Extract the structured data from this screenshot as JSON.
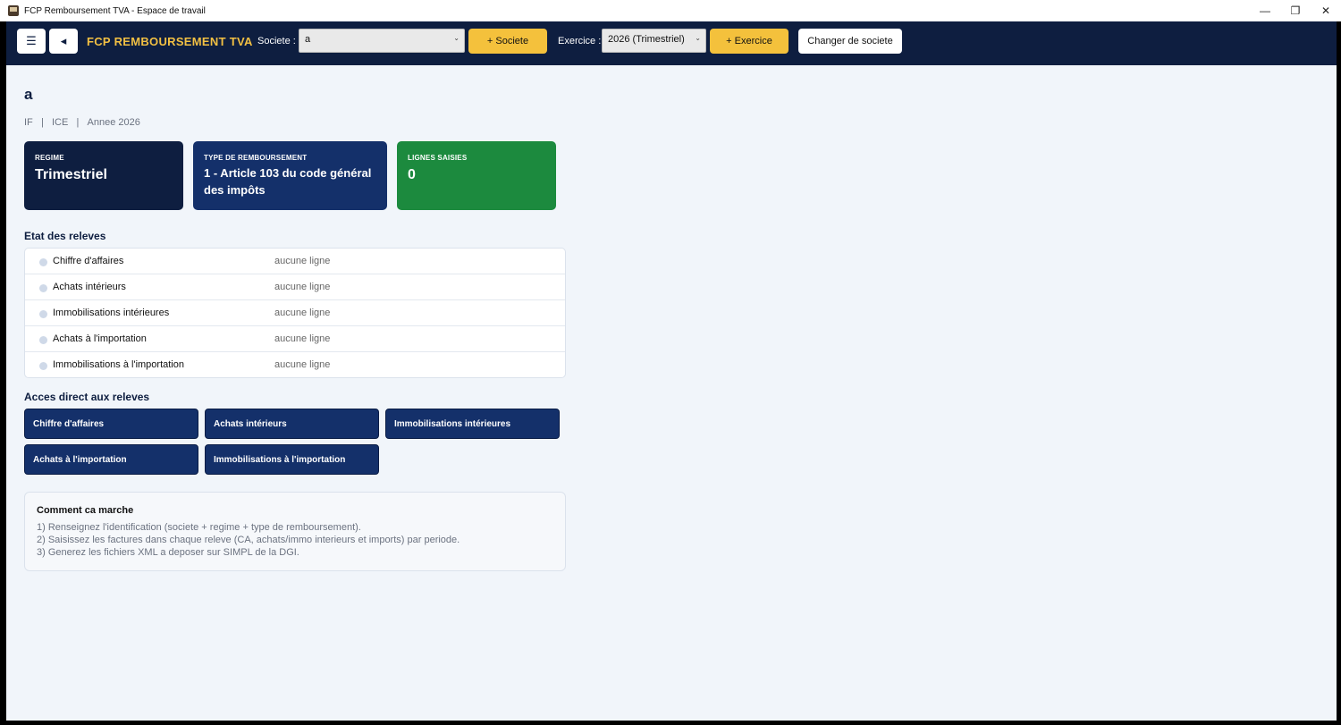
{
  "window": {
    "title": "FCP Remboursement TVA - Espace de travail",
    "controls": [
      "—",
      "❐",
      "✕"
    ]
  },
  "topbar": {
    "menu_icon": "☰",
    "back_icon": "◂",
    "brand": "FCP REMBOURSEMENT TVA",
    "societe_label": "Societe :",
    "societe_value": "a",
    "add_societe": "+ Societe",
    "exercice_label": "Exercice :",
    "exercice_value": "2026 (Trimestriel)",
    "add_exercice": "+ Exercice",
    "change_societe": "Changer de societe",
    "accent_color": "#f4c13c",
    "bar_color": "#0e1e40"
  },
  "main": {
    "company_name": "a",
    "meta": {
      "if": "IF",
      "sep1": "   |   ",
      "ice": "ICE",
      "sep2": "   |   ",
      "annee": "Annee 2026"
    },
    "cards": [
      {
        "caption": "REGIME",
        "value": "Trimestriel",
        "color": "#0e1e40"
      },
      {
        "caption": "TYPE DE REMBOURSEMENT",
        "value": "1 - Article 103 du code général des impôts",
        "color": "#14306a"
      },
      {
        "caption": "LIGNES SAISIES",
        "value": "0",
        "color": "#1c8a3e"
      }
    ],
    "status_title": "Etat des releves",
    "status_rows": [
      {
        "name": "Chiffre d'affaires",
        "state": "aucune ligne"
      },
      {
        "name": "Achats intérieurs",
        "state": "aucune ligne"
      },
      {
        "name": "Immobilisations intérieures",
        "state": "aucune ligne"
      },
      {
        "name": "Achats à l'importation",
        "state": "aucune ligne"
      },
      {
        "name": "Immobilisations à l'importation",
        "state": "aucune ligne"
      }
    ],
    "access_title": "Acces direct aux releves",
    "access_buttons": [
      "Chiffre d'affaires",
      "Achats intérieurs",
      "Immobilisations intérieures",
      "Achats à l'importation",
      "Immobilisations à l'importation"
    ],
    "help": {
      "title": "Comment ca marche",
      "lines": [
        "1) Renseignez l'identification (societe + regime + type de remboursement).",
        "2) Saisissez les factures dans chaque releve (CA, achats/immo interieurs et imports) par periode.",
        "3) Generez les fichiers XML a deposer sur SIMPL de la DGI."
      ]
    }
  }
}
